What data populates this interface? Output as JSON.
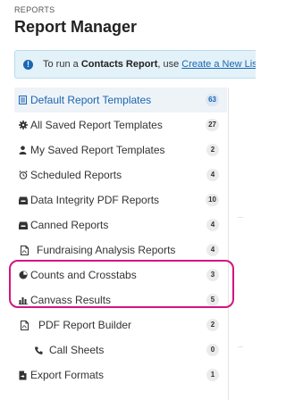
{
  "header": {
    "breadcrumb": "REPORTS",
    "title": "Report Manager"
  },
  "banner": {
    "prefix": "To run a ",
    "bold": "Contacts Report",
    "middle": ", use ",
    "link": "Create a New List"
  },
  "menu": [
    {
      "label": "Default Report Templates",
      "count": "63",
      "icon": "list-icon",
      "active": true
    },
    {
      "label": "All Saved Report Templates",
      "count": "27",
      "icon": "gear-icon"
    },
    {
      "label": "My Saved Report Templates",
      "count": "2",
      "icon": "person-icon"
    },
    {
      "label": "Scheduled Reports",
      "count": "4",
      "icon": "alarm-clock-icon"
    },
    {
      "label": "Data Integrity PDF Reports",
      "count": "10",
      "icon": "inbox-icon"
    },
    {
      "label": "Canned Reports",
      "count": "4",
      "icon": "inbox-icon"
    },
    {
      "label": "Fundraising Analysis Reports",
      "count": "4",
      "icon": "document-icon"
    },
    {
      "label": "Counts and Crosstabs",
      "count": "3",
      "icon": "pie-chart-icon"
    },
    {
      "label": "Canvass Results",
      "count": "5",
      "icon": "bar-chart-icon"
    },
    {
      "label": "PDF Report Builder",
      "count": "2",
      "icon": "document-icon"
    },
    {
      "label": "Call Sheets",
      "count": "0",
      "icon": "phone-icon"
    },
    {
      "label": "Export Formats",
      "count": "1",
      "icon": "export-file-icon"
    }
  ],
  "colors": {
    "accent": "#1a66b0",
    "highlight": "#d3157d",
    "banner_bg": "#e3f1f9"
  }
}
